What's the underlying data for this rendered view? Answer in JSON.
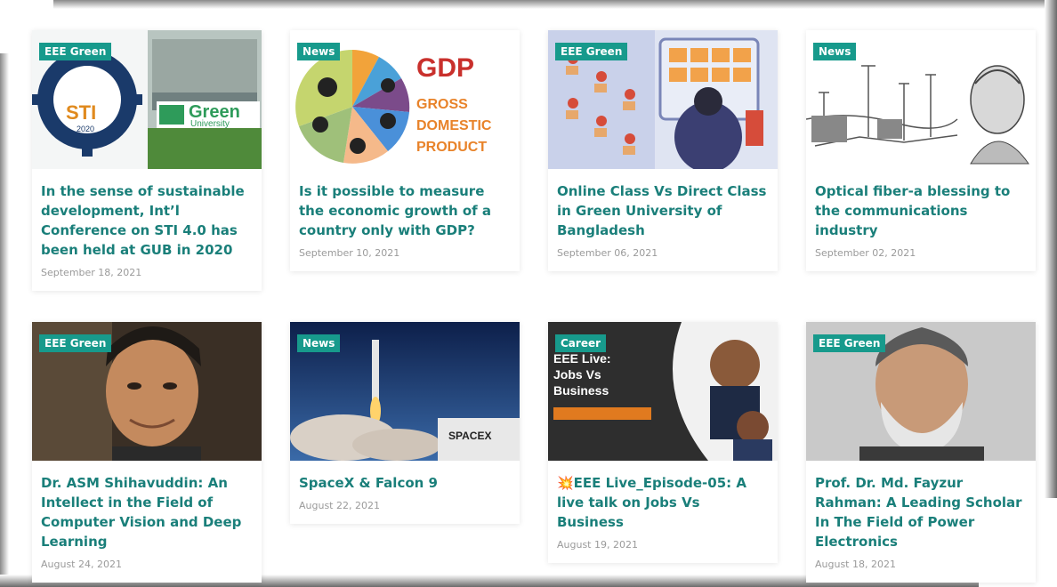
{
  "posts": [
    {
      "category": "EEE Green",
      "title": "In the sense of sustainable development, Int’l Conference on STI 4.0 has been held at GUB in 2020",
      "date": "September 18, 2021",
      "image_alt": "STI 2020 gear logo and Green University building"
    },
    {
      "category": "News",
      "title": "Is it possible to measure the economic growth of a country only with GDP?",
      "date": "September 10, 2021",
      "image_alt": "GDP gross domestic product pie chart"
    },
    {
      "category": "EEE Green",
      "title": "Online Class Vs Direct Class in Green University of Bangladesh",
      "date": "September 06, 2021",
      "image_alt": "classroom vs online class illustration"
    },
    {
      "category": "News",
      "title": "Optical fiber-a blessing to the communications industry",
      "date": "September 02, 2021",
      "image_alt": "sketch of telegraph towers and portrait"
    },
    {
      "category": "EEE Green",
      "title": "Dr. ASM Shihavuddin: An Intellect in the Field of Computer Vision and Deep Learning",
      "date": "August 24, 2021",
      "image_alt": "portrait photo"
    },
    {
      "category": "News",
      "title": "SpaceX & Falcon 9",
      "date": "August 22, 2021",
      "image_alt": "rocket launch"
    },
    {
      "category": "Career",
      "title": "💥EEE Live_Episode-05: A live talk on Jobs Vs Business",
      "date": "August 19, 2021",
      "image_alt": "EEE Live: Jobs Vs Business poster"
    },
    {
      "category": "EEE Green",
      "title": "Prof. Dr. Md. Fayzur Rahman: A Leading Scholar In The Field of Power Electronics",
      "date": "August 18, 2021",
      "image_alt": "portrait photo"
    }
  ],
  "thumb_texts": {
    "sti_logo": "STI",
    "sti_year": "2020",
    "green_university": "Green",
    "green_university_sub": "University",
    "gdp": "GDP",
    "gdp_line1": "GROSS",
    "gdp_line2": "DOMESTIC",
    "gdp_line3": "PRODUCT",
    "eee_live": "EEE Live:",
    "eee_live_sub1": "Jobs Vs",
    "eee_live_sub2": "Business",
    "spacex": "SPACEX"
  },
  "colors": {
    "accent": "#179a8c",
    "title": "#1a7f7a",
    "date": "#9a9a9a"
  }
}
